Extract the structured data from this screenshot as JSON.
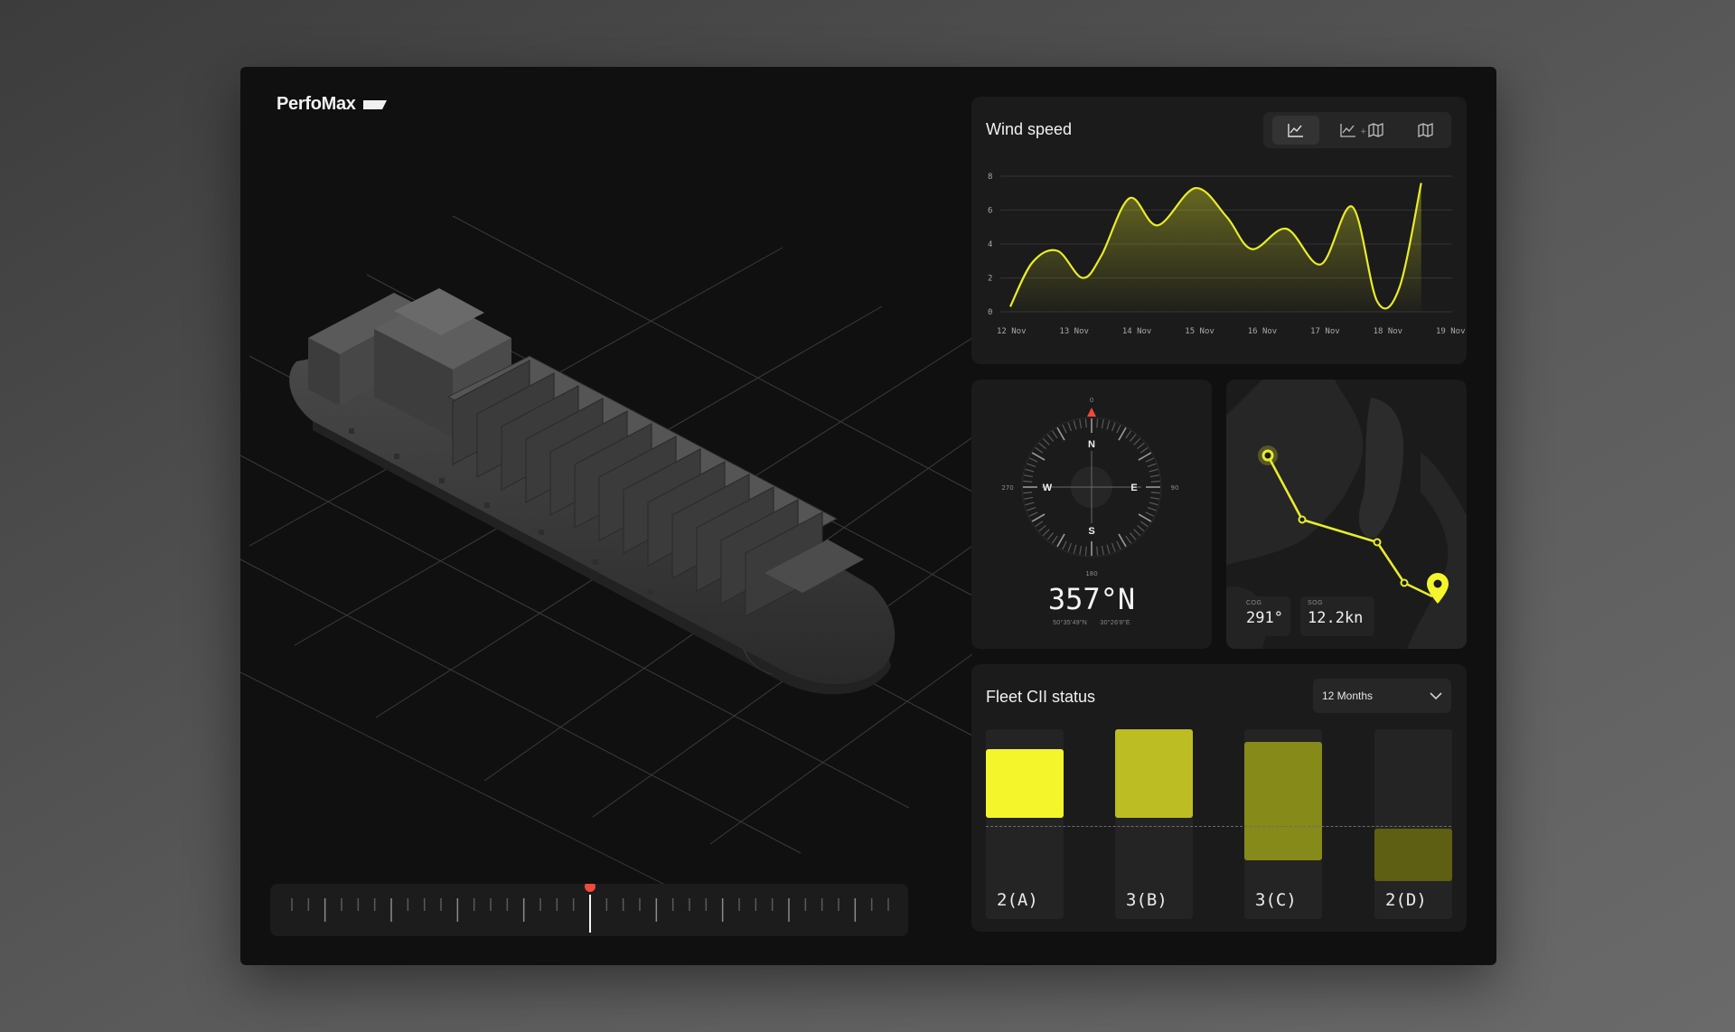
{
  "app": {
    "brand": "PerfoMax"
  },
  "wind_speed": {
    "title": "Wind speed",
    "view_modes": [
      "chart-icon",
      "chart-plus-map-icon",
      "map-icon"
    ],
    "active_view": "chart-icon",
    "chart_data": {
      "type": "area",
      "title": "Wind speed",
      "x": [
        "12 Nov",
        "13 Nov",
        "14 Nov",
        "15 Nov",
        "16 Nov",
        "17 Nov",
        "18 Nov",
        "19 Nov"
      ],
      "series": [
        {
          "color": "#e8ec2a",
          "points": [
            [
              0.0,
              0.3
            ],
            [
              0.35,
              2.9
            ],
            [
              0.75,
              3.6
            ],
            [
              1.15,
              2.0
            ],
            [
              1.45,
              3.3
            ],
            [
              1.9,
              6.7
            ],
            [
              2.35,
              5.1
            ],
            [
              2.95,
              7.3
            ],
            [
              3.45,
              5.6
            ],
            [
              3.85,
              3.7
            ],
            [
              4.4,
              4.9
            ],
            [
              4.95,
              2.8
            ],
            [
              5.45,
              6.2
            ],
            [
              5.85,
              0.6
            ],
            [
              6.2,
              1.4
            ],
            [
              6.55,
              7.6
            ]
          ]
        }
      ],
      "ylim": [
        0,
        8
      ],
      "yticks": [
        0,
        2,
        4,
        6,
        8
      ],
      "grid": true,
      "xlabel": "",
      "ylabel": ""
    }
  },
  "compass": {
    "heading": "357°N",
    "lat": "50°35'49\"N",
    "lon": "30°26'8\"E",
    "cardinals": [
      "N",
      "E",
      "S",
      "W"
    ],
    "degree_labels": [
      "0",
      "90",
      "180",
      "270"
    ]
  },
  "route": {
    "cog_label": "COG",
    "cog_value": "291°",
    "sog_label": "SOG",
    "sog_value": "12.2kn"
  },
  "fleet_cii": {
    "title": "Fleet CII status",
    "period": "12 Months",
    "chart_data": {
      "type": "bar",
      "categories": [
        "2(A)",
        "3(B)",
        "3(C)",
        "2(D)"
      ],
      "values": [
        0.6,
        0.8,
        0.3,
        -0.5
      ],
      "colors": [
        "#f4f52a",
        "#bcbd22",
        "#858a18",
        "#5e5f12"
      ],
      "title": "",
      "xlabel": "",
      "ylabel": ""
    }
  }
}
